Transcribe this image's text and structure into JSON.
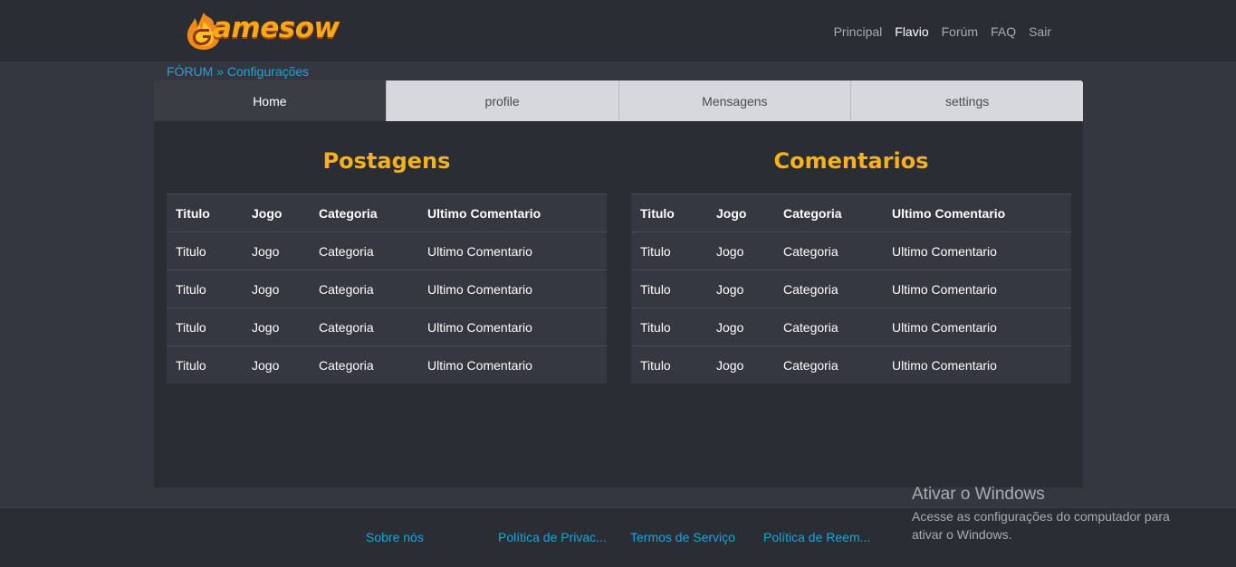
{
  "header": {
    "logo_text": "amesow",
    "nav": [
      "Principal",
      "Flavio",
      "Forúm",
      "FAQ",
      "Sair"
    ],
    "active_nav": "Flavio"
  },
  "breadcrumb": {
    "root": "FÓRUM",
    "separator": "»",
    "current": "Configurações"
  },
  "tabs": [
    "Home",
    "profile",
    "Mensagens",
    "settings"
  ],
  "active_tab": "Home",
  "posts": {
    "title": "Postagens",
    "columns": [
      "Titulo",
      "Jogo",
      "Categoria",
      "Ultimo Comentario"
    ],
    "rows": [
      [
        "Titulo",
        "Jogo",
        "Categoria",
        "Ultimo Comentario"
      ],
      [
        "Titulo",
        "Jogo",
        "Categoria",
        "Ultimo Comentario"
      ],
      [
        "Titulo",
        "Jogo",
        "Categoria",
        "Ultimo Comentario"
      ],
      [
        "Titulo",
        "Jogo",
        "Categoria",
        "Ultimo Comentario"
      ]
    ]
  },
  "comments": {
    "title": "Comentarios",
    "columns": [
      "Titulo",
      "Jogo",
      "Categoria",
      "Ultimo Comentario"
    ],
    "rows": [
      [
        "Titulo",
        "Jogo",
        "Categoria",
        "Ultimo Comentario"
      ],
      [
        "Titulo",
        "Jogo",
        "Categoria",
        "Ultimo Comentario"
      ],
      [
        "Titulo",
        "Jogo",
        "Categoria",
        "Ultimo Comentario"
      ],
      [
        "Titulo",
        "Jogo",
        "Categoria",
        "Ultimo Comentario"
      ]
    ]
  },
  "footer": {
    "links": [
      "Sobre nós",
      "Política de Privac...",
      "Termos de Serviço",
      "Política de Reem..."
    ]
  },
  "watermark": {
    "title": "Ativar o Windows",
    "text": "Acesse as configurações do computador para ativar o Windows."
  },
  "colors": {
    "accent": "#f5b319",
    "link": "#19a6d6",
    "active_tab": "#393e44",
    "tab": "#d7d8dc"
  }
}
